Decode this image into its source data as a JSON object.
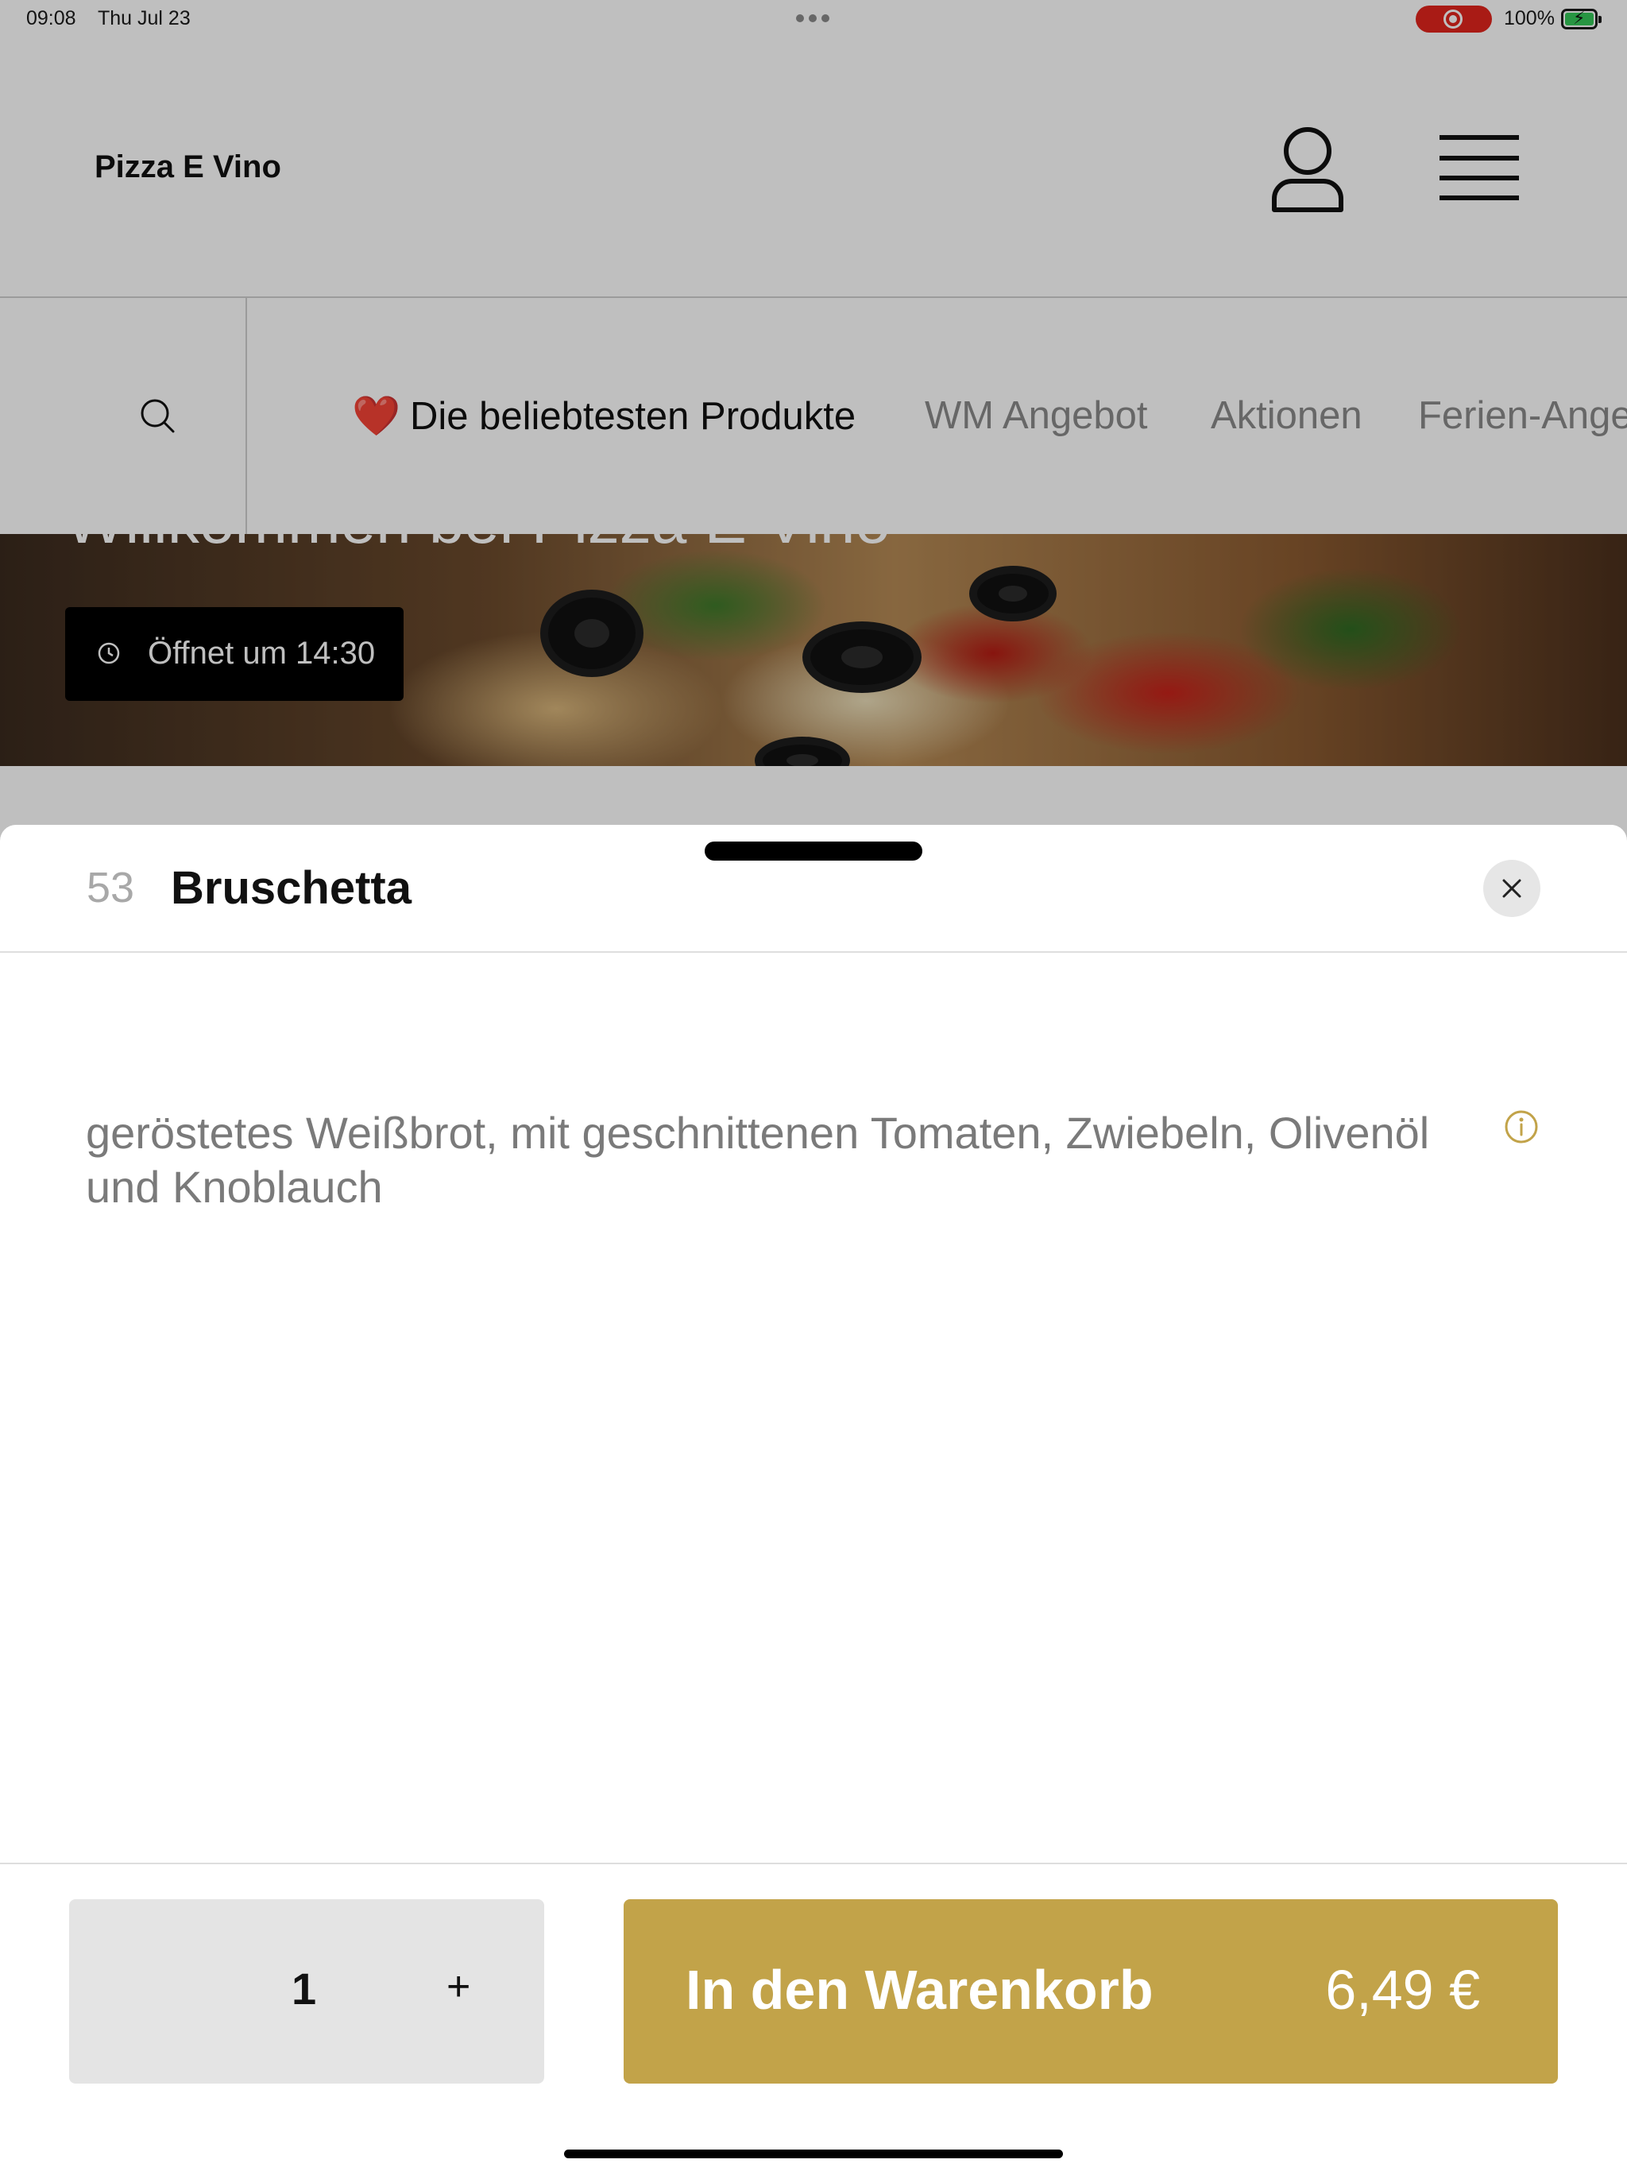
{
  "status_bar": {
    "time": "09:08",
    "date": "Thu Jul 23",
    "battery_percent": "100%"
  },
  "header": {
    "brand": "Pizza E Vino",
    "icons": [
      "profile-icon",
      "hamburger-menu-icon"
    ]
  },
  "categories": {
    "search_icon": "search-icon",
    "tabs": [
      {
        "emoji": "❤️",
        "label": "Die beliebtesten Produkte",
        "active": true
      },
      {
        "label": "WM Angebot",
        "active": false
      },
      {
        "label": "Aktionen",
        "active": false
      },
      {
        "label": "Ferien-Angebot",
        "active": false
      }
    ]
  },
  "hero": {
    "welcome": "Willkommen bei Pizza E Vino",
    "opening": "Öffnet um 14:30"
  },
  "product_sheet": {
    "number": "53",
    "name": "Bruschetta",
    "description": "geröstetes Weißbrot, mit geschnittenen Tomaten, Zwiebeln, Olivenöl und Knoblauch",
    "quantity": "1",
    "plus": "+",
    "add_to_cart": "In den Warenkorb",
    "price": "6,49 €"
  },
  "colors": {
    "accent_gold": "#c2a349",
    "recording_red": "#e2241d",
    "battery_green": "#34c759"
  }
}
